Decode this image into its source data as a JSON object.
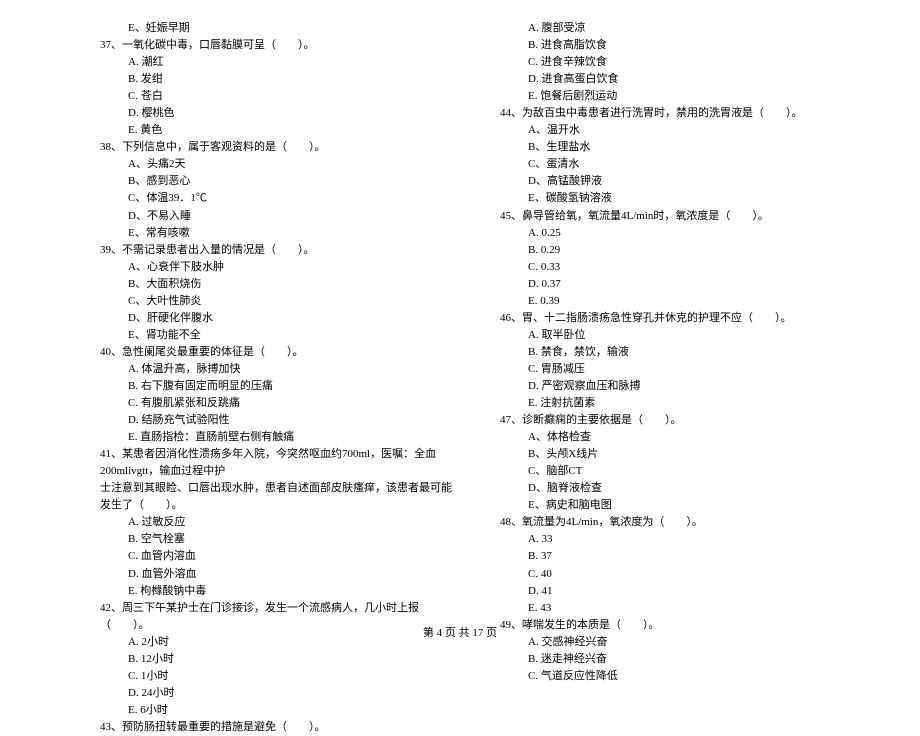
{
  "left_column": [
    {
      "type": "option",
      "text": "E、妊娠早期"
    },
    {
      "type": "question",
      "text": "37、一氧化碳中毒，口唇黏膜可呈（　　）。"
    },
    {
      "type": "option",
      "text": "A. 潮红"
    },
    {
      "type": "option",
      "text": "B. 发绀"
    },
    {
      "type": "option",
      "text": "C. 苍白"
    },
    {
      "type": "option",
      "text": "D. 樱桃色"
    },
    {
      "type": "option",
      "text": "E. 黄色"
    },
    {
      "type": "question",
      "text": "38、下列信息中，属于客观资料的是（　　）。"
    },
    {
      "type": "option",
      "text": "A、头痛2天"
    },
    {
      "type": "option",
      "text": "B、感到恶心"
    },
    {
      "type": "option",
      "text": "C、体温39．1℃"
    },
    {
      "type": "option",
      "text": "D、不易入睡"
    },
    {
      "type": "option",
      "text": "E、常有咳嗽"
    },
    {
      "type": "question",
      "text": "39、不需记录患者出入量的情况是（　　）。"
    },
    {
      "type": "option",
      "text": "A、心衰伴下肢水肿"
    },
    {
      "type": "option",
      "text": "B、大面积烧伤"
    },
    {
      "type": "option",
      "text": "C、大叶性肺炎"
    },
    {
      "type": "option",
      "text": "D、肝硬化伴腹水"
    },
    {
      "type": "option",
      "text": "E、肾功能不全"
    },
    {
      "type": "question",
      "text": "40、急性阑尾炎最重要的体征是（　　）。"
    },
    {
      "type": "option",
      "text": "A. 体温升高，脉搏加快"
    },
    {
      "type": "option",
      "text": "B. 右下腹有固定而明显的压痛"
    },
    {
      "type": "option",
      "text": "C. 有腹肌紧张和反跳痛"
    },
    {
      "type": "option",
      "text": "D. 结肠充气试验阳性"
    },
    {
      "type": "option",
      "text": "E. 直肠指检：直肠前壁右侧有触痛"
    },
    {
      "type": "question",
      "text": "41、某患者因消化性溃疡多年入院，今突然呕血约700ml，医嘱：全血200mlivgtt，输血过程中护"
    },
    {
      "type": "continuation",
      "text": "士注意到其眼睑、口唇出现水肿，患者自述面部皮肤瘙痒，该患者最可能发生了（　　）。"
    },
    {
      "type": "option",
      "text": "A. 过敏反应"
    },
    {
      "type": "option",
      "text": "B. 空气栓塞"
    },
    {
      "type": "option",
      "text": "C. 血管内溶血"
    },
    {
      "type": "option",
      "text": "D. 血管外溶血"
    },
    {
      "type": "option",
      "text": "E. 枸橼酸钠中毒"
    },
    {
      "type": "question",
      "text": "42、周三下午某护士在门诊接诊，发生一个流感病人，几小时上报（　　）。"
    },
    {
      "type": "option",
      "text": "A. 2小时"
    },
    {
      "type": "option",
      "text": "B. 12小时"
    },
    {
      "type": "option",
      "text": "C. 1小时"
    },
    {
      "type": "option",
      "text": "D. 24小时"
    },
    {
      "type": "option",
      "text": "E. 6小时"
    },
    {
      "type": "question",
      "text": "43、预防肠扭转最重要的措施是避免（　　）。"
    }
  ],
  "right_column": [
    {
      "type": "option",
      "text": "A. 腹部受凉"
    },
    {
      "type": "option",
      "text": "B. 进食高脂饮食"
    },
    {
      "type": "option",
      "text": "C. 进食辛辣饮食"
    },
    {
      "type": "option",
      "text": "D. 进食高蛋白饮食"
    },
    {
      "type": "option",
      "text": "E. 饱餐后剧烈运动"
    },
    {
      "type": "question",
      "text": "44、为敌百虫中毒患者进行洗胃时，禁用的洗胃液是（　　）。"
    },
    {
      "type": "option",
      "text": "A、温开水"
    },
    {
      "type": "option",
      "text": "B、生理盐水"
    },
    {
      "type": "option",
      "text": "C、蛋清水"
    },
    {
      "type": "option",
      "text": "D、高锰酸钾液"
    },
    {
      "type": "option",
      "text": "E、碳酸氢钠溶液"
    },
    {
      "type": "question",
      "text": "45、鼻导管给氧，氧流量4L/min时，氧浓度是（　　）。"
    },
    {
      "type": "option",
      "text": "A. 0.25"
    },
    {
      "type": "option",
      "text": "B. 0.29"
    },
    {
      "type": "option",
      "text": "C. 0.33"
    },
    {
      "type": "option",
      "text": "D. 0.37"
    },
    {
      "type": "option",
      "text": "E. 0.39"
    },
    {
      "type": "question",
      "text": "46、胃、十二指肠溃疡急性穿孔并休克的护理不应（　　）。"
    },
    {
      "type": "option",
      "text": "A. 取半卧位"
    },
    {
      "type": "option",
      "text": "B. 禁食，禁饮，输液"
    },
    {
      "type": "option",
      "text": "C. 胃肠减压"
    },
    {
      "type": "option",
      "text": "D. 严密观察血压和脉搏"
    },
    {
      "type": "option",
      "text": "E. 注射抗菌素"
    },
    {
      "type": "question",
      "text": "47、诊断癫痫的主要依据是（　　）。"
    },
    {
      "type": "option",
      "text": "A、体格检查"
    },
    {
      "type": "option",
      "text": "B、头颅X线片"
    },
    {
      "type": "option",
      "text": "C、脑部CT"
    },
    {
      "type": "option",
      "text": "D、脑脊液检查"
    },
    {
      "type": "option",
      "text": "E、病史和脑电图"
    },
    {
      "type": "question",
      "text": "48、氧流量为4L/min，氧浓度为（　　）。"
    },
    {
      "type": "option",
      "text": "A. 33"
    },
    {
      "type": "option",
      "text": "B. 37"
    },
    {
      "type": "option",
      "text": "C. 40"
    },
    {
      "type": "option",
      "text": "D. 41"
    },
    {
      "type": "option",
      "text": "E. 43"
    },
    {
      "type": "question",
      "text": "49、哮喘发生的本质是（　　）。"
    },
    {
      "type": "option",
      "text": "A. 交感神经兴奋"
    },
    {
      "type": "option",
      "text": "B. 迷走神经兴奋"
    },
    {
      "type": "option",
      "text": "C. 气道反应性降低"
    }
  ],
  "footer": "第 4 页 共 17 页"
}
